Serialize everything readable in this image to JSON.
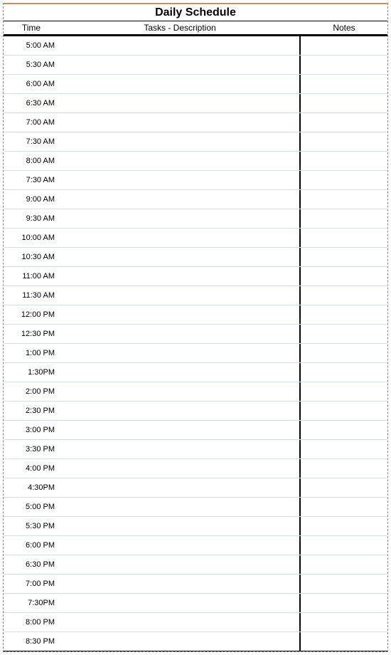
{
  "title": "Daily Schedule",
  "headers": {
    "time": "Time",
    "tasks": "Tasks - Description",
    "notes": "Notes"
  },
  "rows": [
    {
      "time": "5:00 AM",
      "tasks": "",
      "notes": ""
    },
    {
      "time": "5:30 AM",
      "tasks": "",
      "notes": ""
    },
    {
      "time": "6:00 AM",
      "tasks": "",
      "notes": ""
    },
    {
      "time": "6:30 AM",
      "tasks": "",
      "notes": ""
    },
    {
      "time": "7:00 AM",
      "tasks": "",
      "notes": ""
    },
    {
      "time": "7:30 AM",
      "tasks": "",
      "notes": ""
    },
    {
      "time": "8:00 AM",
      "tasks": "",
      "notes": ""
    },
    {
      "time": "7:30 AM",
      "tasks": "",
      "notes": ""
    },
    {
      "time": "9:00 AM",
      "tasks": "",
      "notes": ""
    },
    {
      "time": "9:30 AM",
      "tasks": "",
      "notes": ""
    },
    {
      "time": "10:00 AM",
      "tasks": "",
      "notes": ""
    },
    {
      "time": "10:30 AM",
      "tasks": "",
      "notes": ""
    },
    {
      "time": "11:00 AM",
      "tasks": "",
      "notes": ""
    },
    {
      "time": "11:30 AM",
      "tasks": "",
      "notes": ""
    },
    {
      "time": "12:00 PM",
      "tasks": "",
      "notes": ""
    },
    {
      "time": "12:30 PM",
      "tasks": "",
      "notes": ""
    },
    {
      "time": "1:00 PM",
      "tasks": "",
      "notes": ""
    },
    {
      "time": "1:30PM",
      "tasks": "",
      "notes": ""
    },
    {
      "time": "2:00 PM",
      "tasks": "",
      "notes": ""
    },
    {
      "time": "2:30 PM",
      "tasks": "",
      "notes": ""
    },
    {
      "time": "3:00 PM",
      "tasks": "",
      "notes": ""
    },
    {
      "time": "3:30 PM",
      "tasks": "",
      "notes": ""
    },
    {
      "time": "4:00 PM",
      "tasks": "",
      "notes": ""
    },
    {
      "time": "4:30PM",
      "tasks": "",
      "notes": ""
    },
    {
      "time": "5:00 PM",
      "tasks": "",
      "notes": ""
    },
    {
      "time": "5:30 PM",
      "tasks": "",
      "notes": ""
    },
    {
      "time": "6:00 PM",
      "tasks": "",
      "notes": ""
    },
    {
      "time": "6:30 PM",
      "tasks": "",
      "notes": ""
    },
    {
      "time": "7:00 PM",
      "tasks": "",
      "notes": ""
    },
    {
      "time": "7:30PM",
      "tasks": "",
      "notes": ""
    },
    {
      "time": "8:00 PM",
      "tasks": "",
      "notes": ""
    },
    {
      "time": "8:30 PM",
      "tasks": "",
      "notes": ""
    }
  ]
}
